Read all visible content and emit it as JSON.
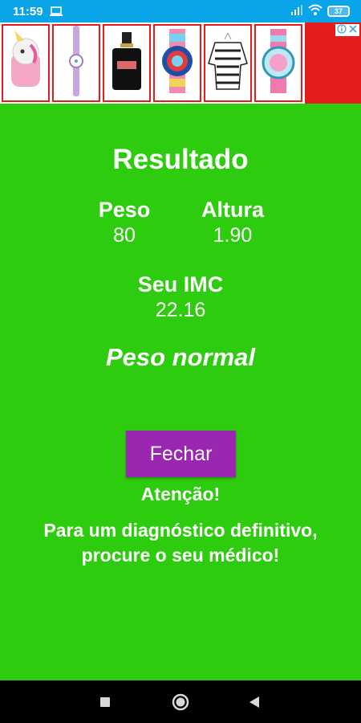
{
  "status_bar": {
    "time": "11:59",
    "battery": "37",
    "icons": [
      "laptop-icon",
      "signal-icon",
      "wifi-icon",
      "battery-icon"
    ]
  },
  "ad": {
    "tiles": [
      "unicorn-watch-icon",
      "kids-watch-icon",
      "perfume-bottle-icon",
      "blue-red-watch-icon",
      "striped-sweater-icon",
      "teal-watch-icon"
    ],
    "badge_icons": [
      "info-icon",
      "close-icon"
    ]
  },
  "result": {
    "title": "Resultado",
    "weight_label": "Peso",
    "weight_value": "80",
    "height_label": "Altura",
    "height_value": "1.90",
    "bmi_label": "Seu IMC",
    "bmi_value": "22.16",
    "classification": "Peso normal"
  },
  "actions": {
    "close_label": "Fechar"
  },
  "warning": {
    "title": "Atenção!",
    "text": "Para um diagnóstico definitivo, procure o seu médico!"
  },
  "nav": {
    "icons": [
      "recent-apps-icon",
      "home-icon",
      "back-icon"
    ]
  },
  "colors": {
    "background": "#2ecc0e",
    "status_bar": "#0aa4e8",
    "button": "#9a27b0",
    "ad_border": "#e41c1c"
  }
}
